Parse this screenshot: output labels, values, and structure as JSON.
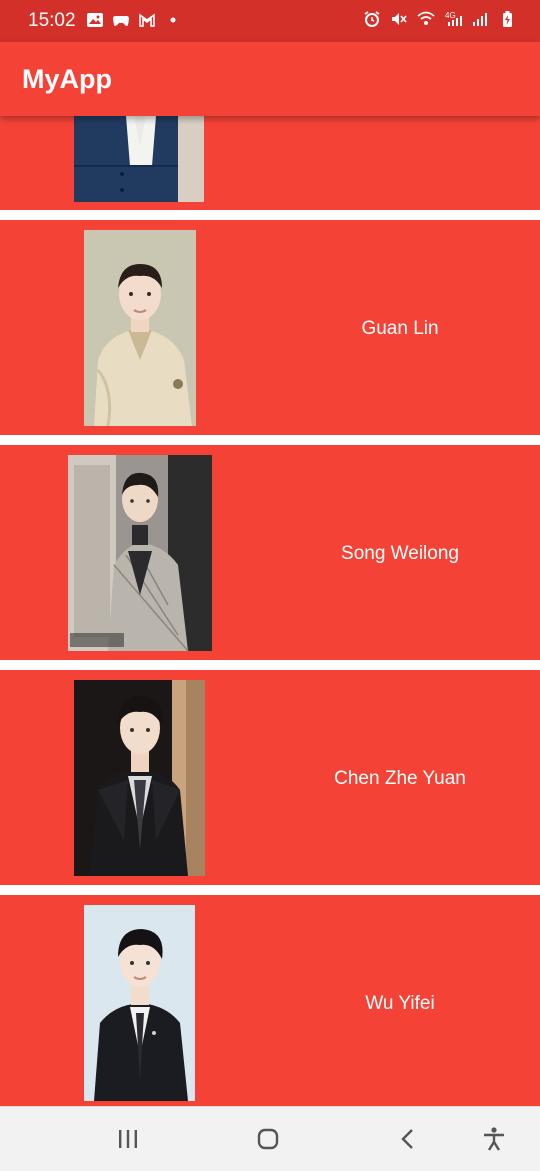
{
  "status_bar": {
    "time": "15:02",
    "left_icons": [
      "image-icon",
      "game-controller-icon",
      "gmail-icon",
      "dot-icon"
    ],
    "right_icons": [
      "alarm-icon",
      "mute-icon",
      "wifi-icon",
      "signal-4g-icon",
      "signal-icon",
      "battery-charging-icon"
    ]
  },
  "app_bar": {
    "title": "MyApp"
  },
  "list": {
    "items": [
      {
        "name": "",
        "photo": "person-photo"
      },
      {
        "name": "Guan Lin",
        "photo": "person-photo"
      },
      {
        "name": "Song Weilong",
        "photo": "person-photo"
      },
      {
        "name": "Chen Zhe Yuan",
        "photo": "person-photo"
      },
      {
        "name": "Wu Yifei",
        "photo": "person-photo"
      }
    ]
  },
  "nav_bar": {
    "buttons": [
      "recent-apps-icon",
      "home-icon",
      "back-icon",
      "accessibility-icon"
    ]
  },
  "colors": {
    "status_bar": "#d3302a",
    "app_bar": "#f44336",
    "row_background": "#f44336",
    "divider": "#ffffff",
    "nav_bar": "#f2f2f2"
  }
}
